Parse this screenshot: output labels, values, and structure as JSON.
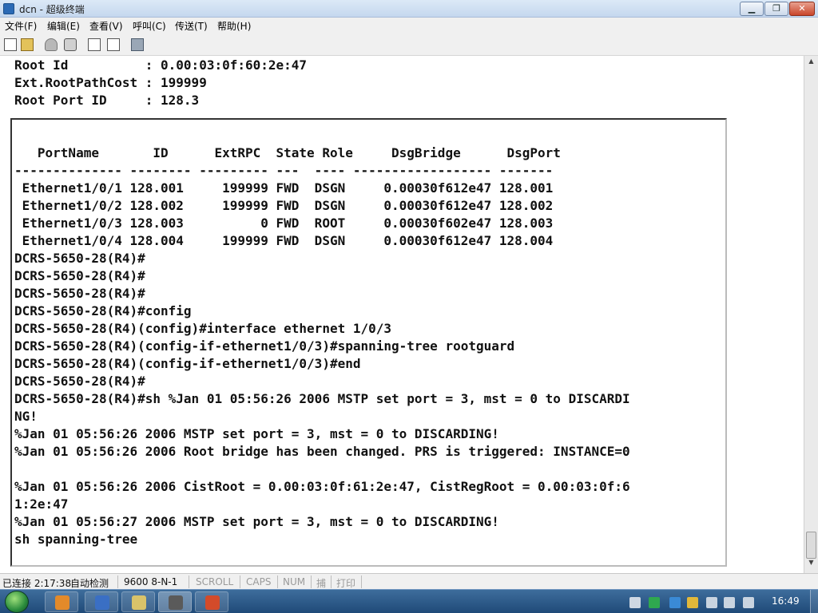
{
  "window": {
    "title": "dcn - 超级终端"
  },
  "menu": [
    "文件(F)",
    "编辑(E)",
    "查看(V)",
    "呼叫(C)",
    "传送(T)",
    "帮助(H)"
  ],
  "toolbar": [
    "new-icon",
    "open-icon",
    "phone-icon",
    "hangup-icon",
    "send-icon",
    "receive-icon",
    "properties-icon"
  ],
  "terminal": {
    "top_lines": [
      "Root Id          : 0.00:03:0f:60:2e:47",
      "Ext.RootPathCost : 199999",
      "Root Port ID     : 128.3"
    ],
    "lines": [
      "   PortName       ID      ExtRPC  State Role     DsgBridge      DsgPort",
      "-------------- -------- --------- ---  ---- ------------------ -------",
      " Ethernet1/0/1 128.001     199999 FWD  DSGN     0.00030f612e47 128.001",
      " Ethernet1/0/2 128.002     199999 FWD  DSGN     0.00030f612e47 128.002",
      " Ethernet1/0/3 128.003          0 FWD  ROOT     0.00030f602e47 128.003",
      " Ethernet1/0/4 128.004     199999 FWD  DSGN     0.00030f612e47 128.004",
      "DCRS-5650-28(R4)#",
      "DCRS-5650-28(R4)#",
      "DCRS-5650-28(R4)#",
      "DCRS-5650-28(R4)#config",
      "DCRS-5650-28(R4)(config)#interface ethernet 1/0/3",
      "DCRS-5650-28(R4)(config-if-ethernet1/0/3)#spanning-tree rootguard",
      "DCRS-5650-28(R4)(config-if-ethernet1/0/3)#end",
      "DCRS-5650-28(R4)#",
      "DCRS-5650-28(R4)#sh %Jan 01 05:56:26 2006 MSTP set port = 3, mst = 0 to DISCARDI",
      "NG!",
      "%Jan 01 05:56:26 2006 MSTP set port = 3, mst = 0 to DISCARDING!",
      "%Jan 01 05:56:26 2006 Root bridge has been changed. PRS is triggered: INSTANCE=0",
      "",
      "%Jan 01 05:56:26 2006 CistRoot = 0.00:03:0f:61:2e:47, CistRegRoot = 0.00:03:0f:6",
      "1:2e:47",
      "%Jan 01 05:56:27 2006 MSTP set port = 3, mst = 0 to DISCARDING!",
      "sh spanning-tree"
    ]
  },
  "status": {
    "connection": "已连接 2:17:38",
    "detect": "自动检测",
    "params": "9600 8-N-1",
    "scroll": "SCROLL",
    "caps": "CAPS",
    "num": "NUM",
    "capture": "捕",
    "print": "打印"
  },
  "taskbar": {
    "clock": "16:49"
  }
}
